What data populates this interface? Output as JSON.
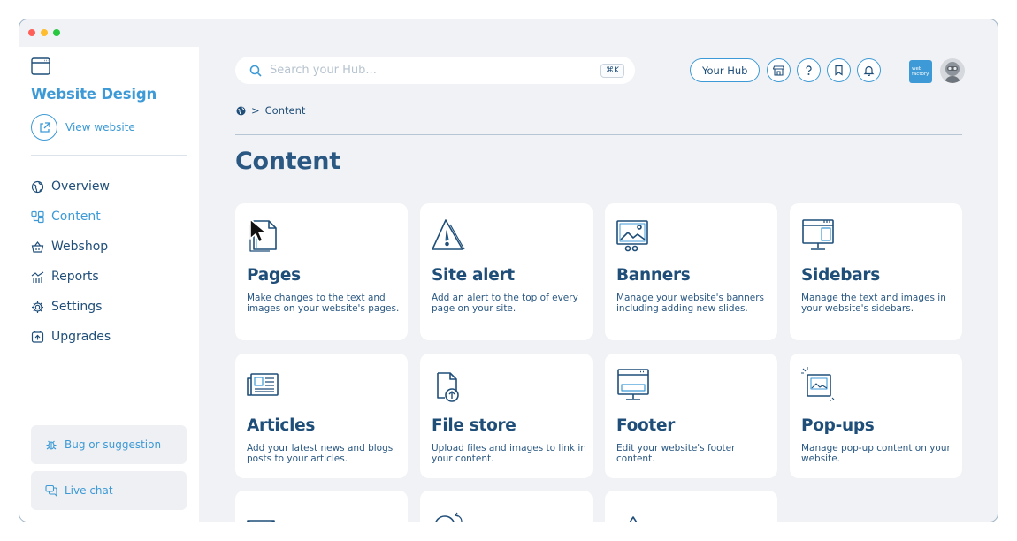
{
  "window": {
    "dots": [
      "#ff5f57",
      "#febc2e",
      "#28c840"
    ]
  },
  "sidebar": {
    "site_title": "Website Design",
    "view_website": "View website",
    "nav": [
      {
        "label": "Overview",
        "icon": "globe-icon"
      },
      {
        "label": "Content",
        "icon": "layout-icon",
        "active": true
      },
      {
        "label": "Webshop",
        "icon": "basket-icon"
      },
      {
        "label": "Reports",
        "icon": "chart-icon"
      },
      {
        "label": "Settings",
        "icon": "gear-icon"
      },
      {
        "label": "Upgrades",
        "icon": "upgrade-icon"
      }
    ],
    "bug_label": "Bug or suggestion",
    "chat_label": "Live chat"
  },
  "header": {
    "search_placeholder": "Search your Hub...",
    "search_shortcut": "⌘K",
    "hub_button": "Your Hub",
    "logo_text": "web factory"
  },
  "breadcrumb": {
    "current": "Content"
  },
  "main": {
    "title": "Content",
    "cards": [
      {
        "title": "Pages",
        "desc": "Make changes to the text and images on your website's pages.",
        "icon": "pages-icon"
      },
      {
        "title": "Site alert",
        "desc": "Add an alert to the top of every page on your site.",
        "icon": "alert-icon"
      },
      {
        "title": "Banners",
        "desc": "Manage your website's banners including adding new slides.",
        "icon": "banners-icon"
      },
      {
        "title": "Sidebars",
        "desc": "Manage the text and images in your website's sidebars.",
        "icon": "sidebars-icon"
      },
      {
        "title": "Articles",
        "desc": "Add your latest news and blogs posts to your articles.",
        "icon": "articles-icon"
      },
      {
        "title": "File store",
        "desc": "Upload files and images to link in your content.",
        "icon": "file-store-icon"
      },
      {
        "title": "Footer",
        "desc": "Edit your website's footer content.",
        "icon": "footer-icon"
      },
      {
        "title": "Pop-ups",
        "desc": "Manage pop-up content on your website.",
        "icon": "popups-icon"
      }
    ]
  },
  "colors": {
    "accent": "#3d9ad6",
    "navy": "#1f4e79",
    "background": "#f1f2f5"
  }
}
